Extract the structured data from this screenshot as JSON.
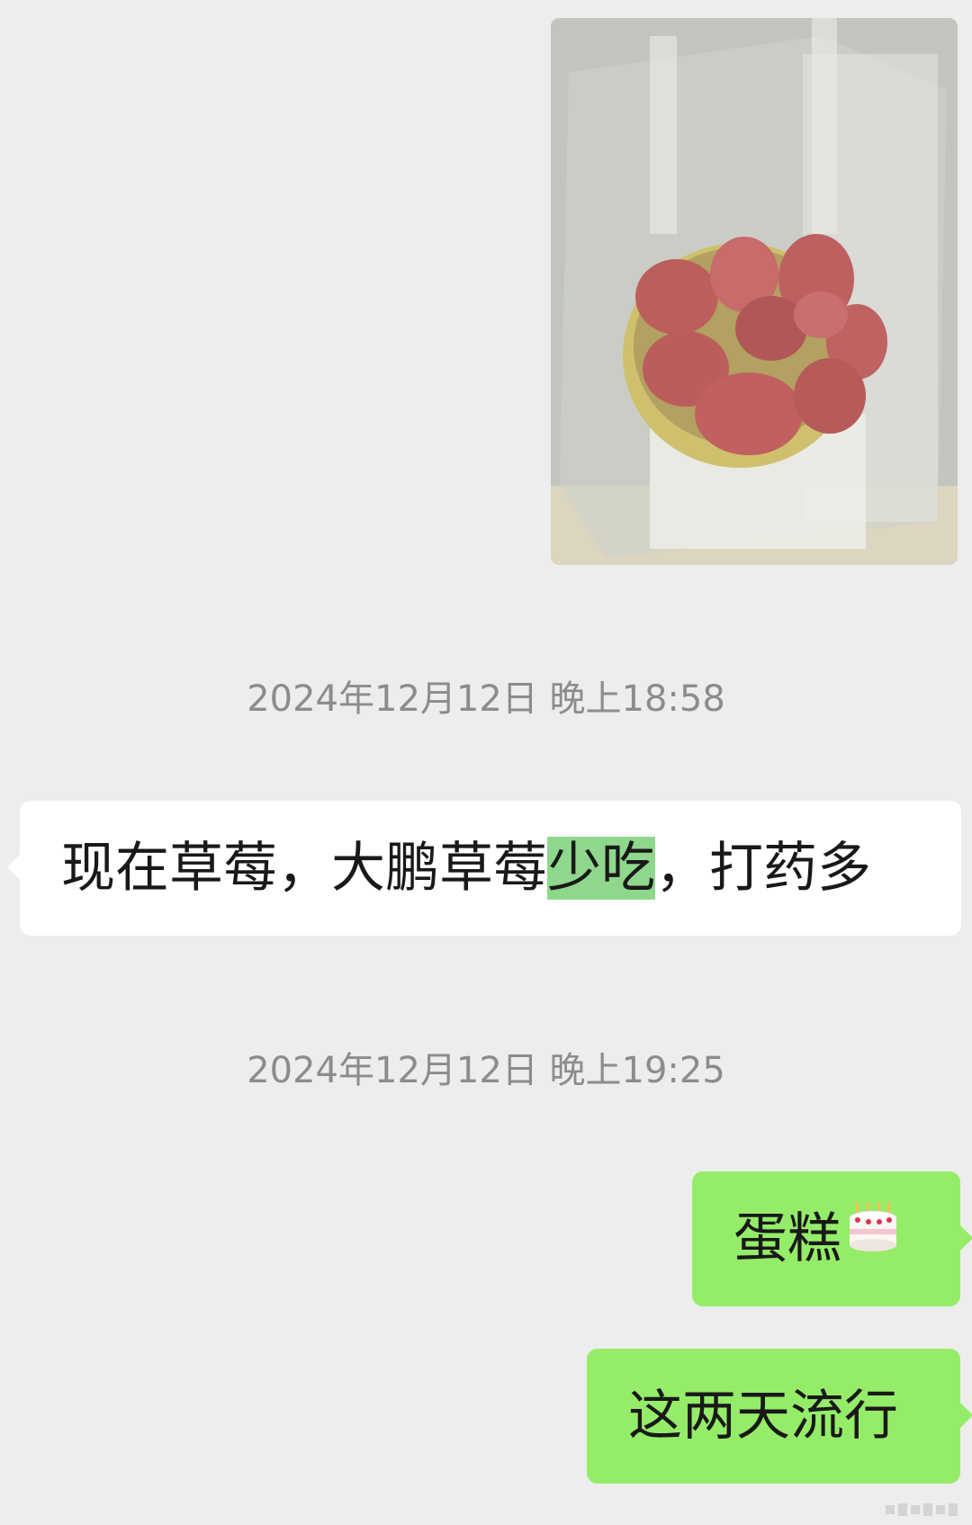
{
  "chat": {
    "messages": [
      {
        "kind": "image",
        "direction": "outgoing",
        "description_icon": "photo-strawberries"
      },
      {
        "kind": "timestamp",
        "text": "2024年12月12日 晚上18:58"
      },
      {
        "kind": "text",
        "direction": "incoming",
        "text_before": "现在草莓，大鹏草莓",
        "text_highlight": "少吃",
        "text_after": "，打药多"
      },
      {
        "kind": "timestamp",
        "text": "2024年12月12日 晚上19:25"
      },
      {
        "kind": "text",
        "direction": "outgoing",
        "text": "蛋糕",
        "emoji": "cake-icon"
      },
      {
        "kind": "text",
        "direction": "outgoing",
        "text": "这两天流行"
      }
    ]
  },
  "colors": {
    "background": "#ededed",
    "incoming_bubble": "#ffffff",
    "outgoing_bubble": "#95ec69",
    "highlight": "#8fd78c",
    "timestamp_text": "#8c8c8c"
  }
}
